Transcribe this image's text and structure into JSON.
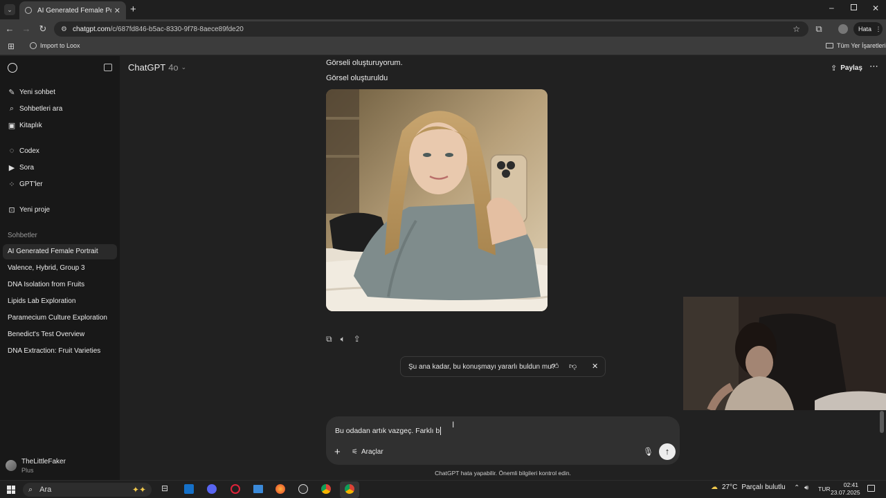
{
  "browser": {
    "tab_title": "AI Generated Female Portrait",
    "url_domain": "chatgpt.com",
    "url_path": "/c/687fd846-b5ac-8330-9f78-8aece89fde20",
    "profile_label": "Hata",
    "bookmark_item": "Import to Loox",
    "bookmarks_folder": "Tüm Yer İşaretleri"
  },
  "sidebar": {
    "nav": [
      {
        "label": "Yeni sohbet",
        "icon": "edit-icon"
      },
      {
        "label": "Sohbetleri ara",
        "icon": "search-icon"
      },
      {
        "label": "Kitaplık",
        "icon": "library-icon"
      },
      {
        "label": "Codex",
        "icon": "codex-icon"
      },
      {
        "label": "Sora",
        "icon": "sora-icon"
      },
      {
        "label": "GPT'ler",
        "icon": "gpts-icon"
      },
      {
        "label": "Yeni proje",
        "icon": "folder-icon"
      }
    ],
    "section_title": "Sohbetler",
    "chats": [
      "AI Generated Female Portrait",
      "Valence, Hybrid, Group 3",
      "DNA Isolation from Fruits",
      "Lipids Lab Exploration",
      "Paramecium Culture Exploration",
      "Benedict's Test Overview",
      "DNA Extraction: Fruit Varieties"
    ],
    "user_name": "TheLittleFaker",
    "user_plan": "Plus"
  },
  "header": {
    "model": "ChatGPT",
    "model_version": "4o",
    "share_label": "Paylaş"
  },
  "conversation": {
    "status_line": "Görseli oluşturuyorum.",
    "image_caption": "Görsel oluşturuldu",
    "feedback_question": "Şu ana kadar, bu konuşmayı yararlı buldun mu?"
  },
  "composer": {
    "input_value": "Bu odadan artık vazgeç. Farklı b",
    "tools_label": "Araçlar",
    "disclaimer": "ChatGPT hata yapabilir. Önemli bilgileri kontrol edin."
  },
  "taskbar": {
    "search_placeholder": "Ara",
    "weather_temp": "27°C",
    "weather_desc": "Parçalı bulutlu",
    "language": "TUR",
    "time": "02:41",
    "date": "23.07.2025"
  }
}
